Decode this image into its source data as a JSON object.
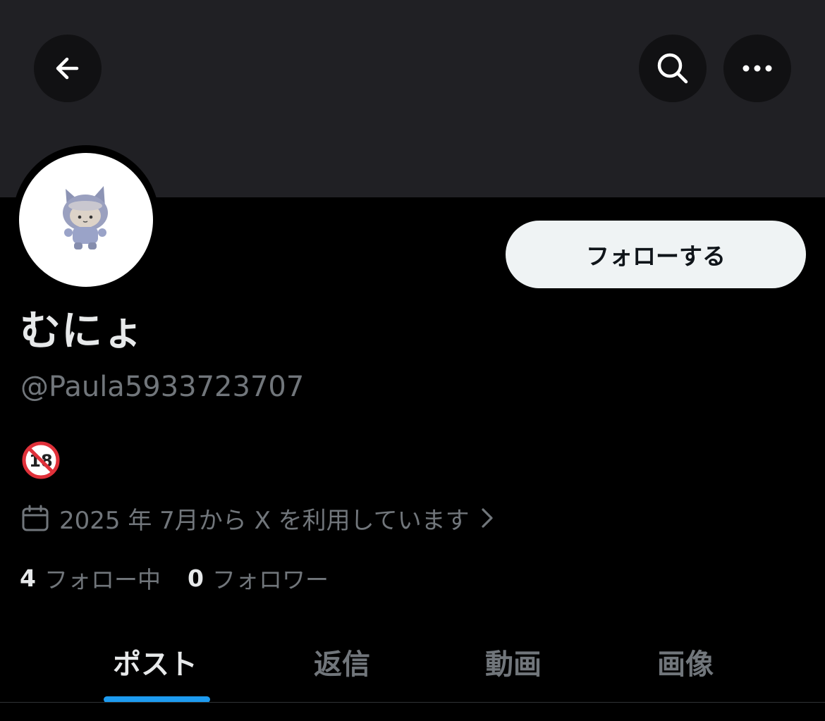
{
  "header": {
    "back_icon": "arrow-left-icon",
    "search_icon": "search-icon",
    "more_icon": "more-horizontal-icon",
    "banner_color": "#202024"
  },
  "profile": {
    "display_name": "むにょ",
    "handle": "@Paula5933723707",
    "bio_icon": "no-under-18-emoji",
    "joined_text": "2025 年 7月から X を利用しています",
    "follow_button_label": "フォローする"
  },
  "stats": {
    "following_count": "4",
    "following_label": "フォロー中",
    "followers_count": "0",
    "followers_label": "フォロワー"
  },
  "tabs": [
    {
      "label": "ポスト",
      "active": true
    },
    {
      "label": "返信",
      "active": false
    },
    {
      "label": "動画",
      "active": false
    },
    {
      "label": "画像",
      "active": false
    }
  ],
  "colors": {
    "accent": "#1d9bf0",
    "text_primary": "#e7e9ea",
    "text_secondary": "#71767b",
    "follow_button_bg": "#eff3f4"
  }
}
